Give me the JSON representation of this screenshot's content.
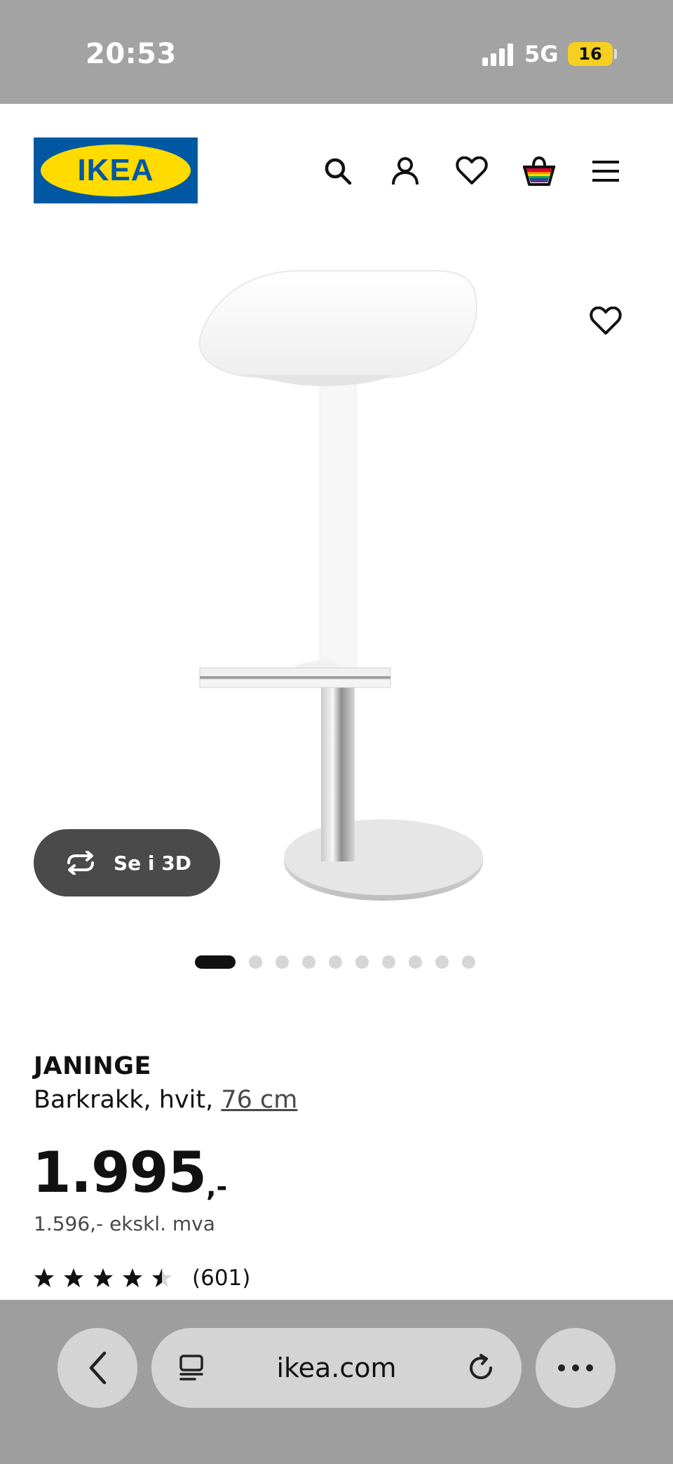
{
  "status_bar": {
    "time": "20:53",
    "network": "5G",
    "battery": "16"
  },
  "header": {
    "logo_text": "IKEA"
  },
  "gallery": {
    "view_3d_label": "Se i 3D",
    "slide_count": 10,
    "active_slide": 1
  },
  "product": {
    "name": "JANINGE",
    "description": "Barkrakk, hvit, ",
    "size_link": "76 cm",
    "price": "1.995",
    "price_suffix": ",-",
    "price_ex_vat": "1.596,- ekskl. mva",
    "rating": 4.5,
    "rating_max": 5,
    "rating_count": "(601)"
  },
  "browser": {
    "url": "ikea.com"
  },
  "colors": {
    "ikea_blue": "#0058a3",
    "ikea_yellow": "#ffdb00",
    "status_bar_bg": "#a3a3a3",
    "browser_bar_bg": "#9e9e9e",
    "button_3d_bg": "#4a4a4a"
  }
}
